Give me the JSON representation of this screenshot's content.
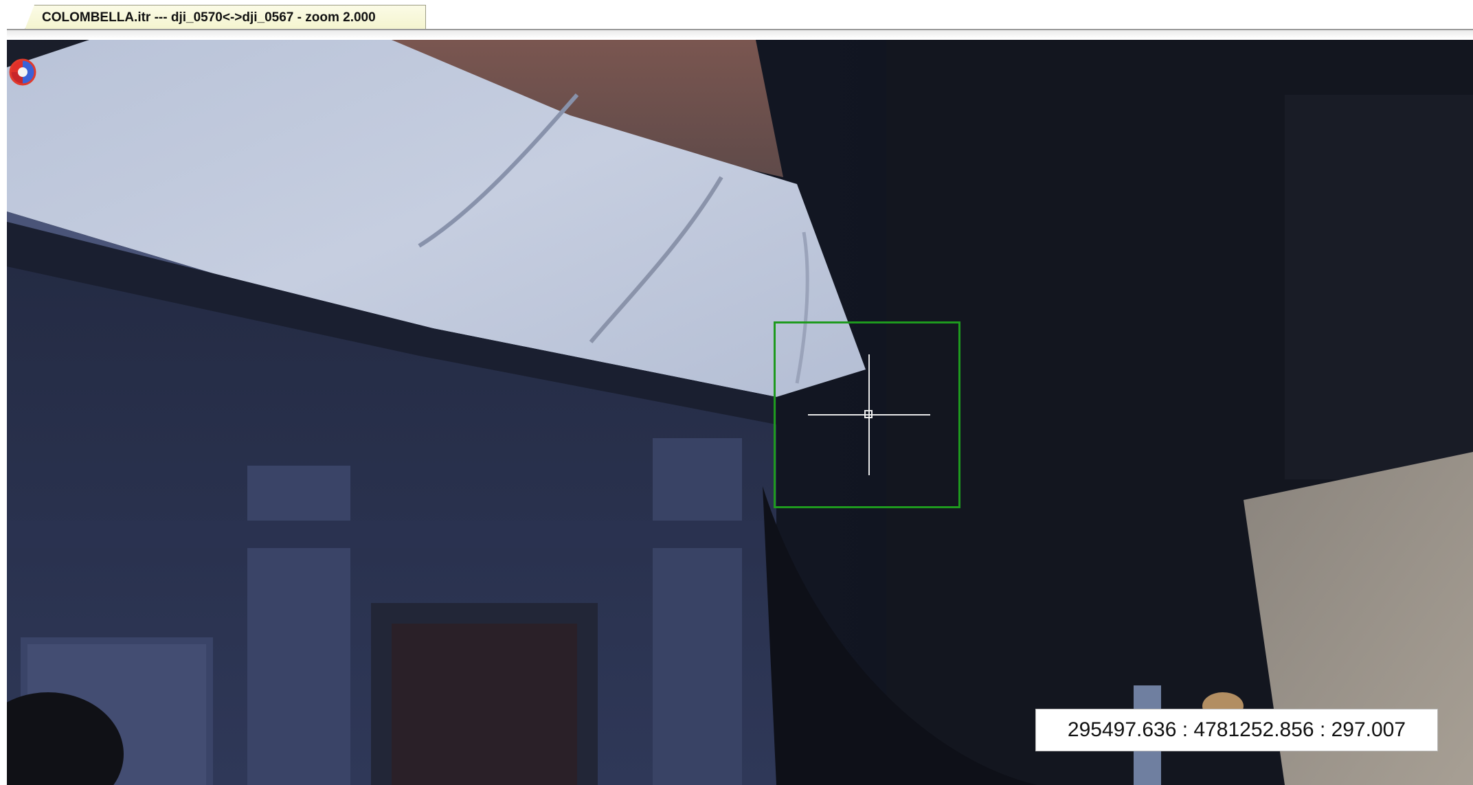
{
  "tab": {
    "title": "COLOMBELLA.itr --- dji_0570<->dji_0567 - zoom 2.000",
    "close_icon": "close-icon"
  },
  "viewport": {
    "compass_icon": "orientation-compass-icon",
    "target_box_color": "#1e9a1e",
    "crosshair_color": "#e8e8e8"
  },
  "coordinates": {
    "readout": "295497.636 : 4781252.856 : 297.007"
  }
}
